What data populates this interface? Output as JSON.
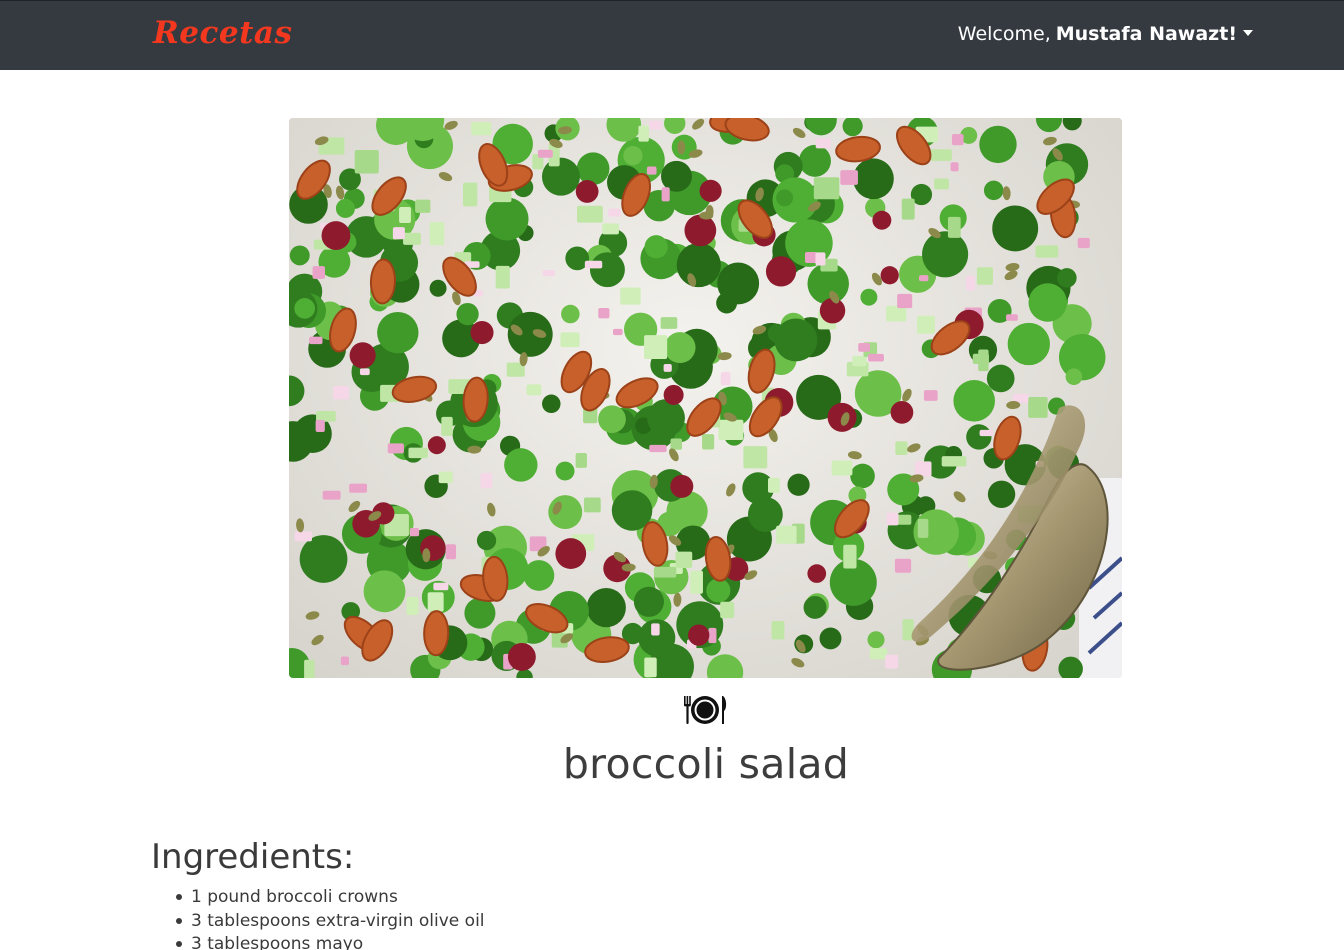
{
  "navbar": {
    "brand": "Recetas",
    "welcome": "Welcome,",
    "username": "Mustafa Nawazt!"
  },
  "recipe": {
    "image_alt": "broccoli salad",
    "icon": "plate-with-utensils-icon",
    "title": "broccoli salad"
  },
  "ingredients": {
    "heading": "Ingredients:",
    "items": [
      "1 pound broccoli crowns",
      "3 tablespoons extra-virgin olive oil",
      "3 tablespoons mayo"
    ]
  },
  "colors": {
    "navbar_bg": "#343a40",
    "brand": "#f4381f",
    "text": "#3a3a3a"
  }
}
